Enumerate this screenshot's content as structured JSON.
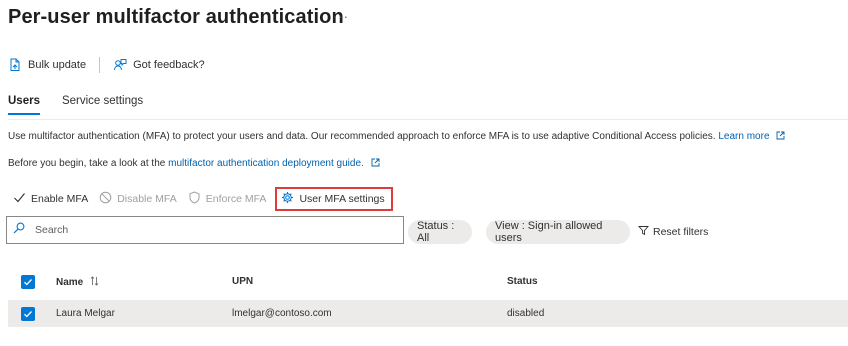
{
  "page": {
    "title": "Per-user multifactor authentication",
    "more": "···"
  },
  "toolbar": {
    "bulk_update": "Bulk update",
    "feedback": "Got feedback?"
  },
  "tabs": [
    {
      "label": "Users",
      "active": true
    },
    {
      "label": "Service settings",
      "active": false
    }
  ],
  "info": {
    "line1_text": "Use multifactor authentication (MFA) to protect your users and data. Our recommended approach to enforce MFA is to use adaptive Conditional Access policies.",
    "line1_link": "Learn more",
    "line2_text": "Before you begin, take a look at the",
    "line2_link": "multifactor authentication deployment guide."
  },
  "actions": {
    "enable": "Enable MFA",
    "disable": "Disable MFA",
    "enforce": "Enforce MFA",
    "settings": "User MFA settings"
  },
  "search": {
    "placeholder": "Search"
  },
  "filters": {
    "status": "Status : All",
    "view": "View : Sign-in allowed users",
    "reset": "Reset filters"
  },
  "table": {
    "columns": [
      "Name",
      "UPN",
      "Status"
    ],
    "rows": [
      {
        "name": "Laura Melgar",
        "upn": "lmelgar@contoso.com",
        "status": "disabled",
        "selected": true
      }
    ]
  },
  "colors": {
    "accent": "#0078d4",
    "highlight_border": "#e03b3b",
    "link": "#0062ad"
  }
}
